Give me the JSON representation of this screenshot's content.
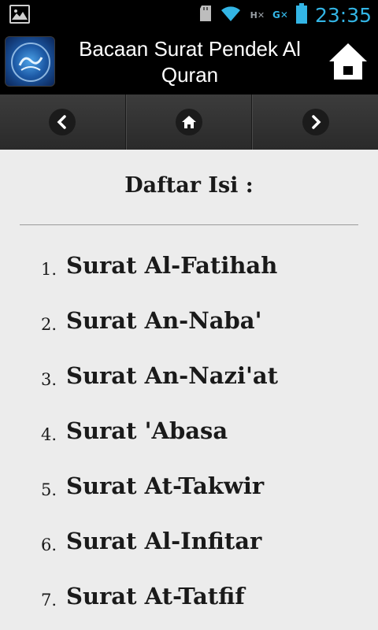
{
  "status_bar": {
    "time": "23:35",
    "network_label": "H",
    "gx_label": "G",
    "icons": [
      "image-notification-icon",
      "sd-card-icon",
      "wifi-icon",
      "signal-icon",
      "data-icon",
      "battery-icon"
    ]
  },
  "action_bar": {
    "title": "Bacaan Surat Pendek Al Quran",
    "app_icon": "quran-app-icon",
    "home_icon": "home-icon"
  },
  "nav_bar": {
    "items": [
      {
        "icon": "chevron-left-icon"
      },
      {
        "icon": "home-icon"
      },
      {
        "icon": "chevron-right-icon"
      }
    ]
  },
  "content": {
    "heading": "Daftar Isi :",
    "items": [
      {
        "num": "1.",
        "label": "Surat Al-Fatihah"
      },
      {
        "num": "2.",
        "label": "Surat An-Naba'"
      },
      {
        "num": "3.",
        "label": "Surat An-Nazi'at"
      },
      {
        "num": "4.",
        "label": "Surat 'Abasa"
      },
      {
        "num": "5.",
        "label": "Surat At-Takwir"
      },
      {
        "num": "6.",
        "label": "Surat Al-Infitar"
      },
      {
        "num": "7.",
        "label": "Surat At-Tatfif"
      }
    ]
  },
  "colors": {
    "status_accent": "#33b5e5",
    "bar_background": "#000000",
    "content_background": "#ececec"
  }
}
